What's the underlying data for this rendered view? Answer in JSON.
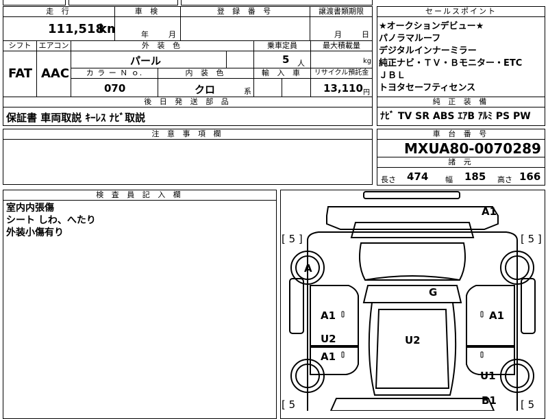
{
  "top_row": {
    "mileage_header": "走 行",
    "shaken_header": "車 検",
    "reg_header": "登 録 番 号",
    "transfer_header": "譲渡書類期限",
    "sales_header": "セールスポイント"
  },
  "mileage": {
    "value": "111,518",
    "unit": "km"
  },
  "shaken": {
    "year_unit": "年",
    "month_unit": "月"
  },
  "transfer": {
    "month_unit": "月",
    "day_unit": "日"
  },
  "row2_headers": {
    "shift": "シフト",
    "aircon": "エアコン",
    "exterior": "外 装 色",
    "capacity": "乗車定員",
    "max_load": "最大積載量"
  },
  "shift": "FAT",
  "aircon": "AAC",
  "exterior_color": "パール",
  "capacity": {
    "value": "5",
    "unit": "人"
  },
  "max_load": {
    "unit": "kg"
  },
  "row3_headers": {
    "color_no": "カ ラ ー Ｎ ｏ.",
    "interior": "内 装 色",
    "import": "輸 入 車",
    "recycle": "リサイクル預託金"
  },
  "color_no": "070",
  "interior_color": {
    "value": "クロ",
    "suffix": "系"
  },
  "recycle": {
    "value": "13,110",
    "unit": "円"
  },
  "sales_points": [
    "★オークションデビュー★",
    "パノラマルーフ",
    "デジタルインナーミラー",
    "純正ナビ・ＴＶ・Ｂモニター・ETC",
    "ＪＢＬ",
    "トヨタセーフティセンス"
  ],
  "after_parts": {
    "header": "後 日 発 送 部 品",
    "value": "保証書 車両取説 ｷｰﾚｽ ﾅﾋﾞ取説"
  },
  "equipment": {
    "header": "純 正 装 備",
    "value": "ﾅﾋﾞ TV SR ABS ｴｱB ｱﾙﾐ PS PW"
  },
  "notes": {
    "header": "注 意 事 項 欄"
  },
  "chassis": {
    "header": "車 台 番 号",
    "value": "MXUA80-0070289"
  },
  "specs": {
    "header": "諸 元",
    "length_label": "長さ",
    "length": "474",
    "width_label": "幅",
    "width": "185",
    "height_label": "高さ",
    "height": "166"
  },
  "inspector": {
    "header": "検 査 員 記 入 欄",
    "lines": [
      "室内内張傷",
      "シート しわ、へたり",
      "外装小傷有り"
    ]
  },
  "diagram": {
    "tire_left_top": "[ 5 ]",
    "tire_right_top": "[ 5 ]",
    "tire_left_bottom": "[ 5",
    "tire_right_bottom": "[ 5",
    "marks": {
      "front_bumper": "A1",
      "left_front_wheel": "A",
      "roof": "G",
      "left_front_door": "A1",
      "right_front_door": "A1",
      "left_rear_door_u": "U2",
      "left_rear_door_a": "A1",
      "rear_glass": "U2",
      "right_rear_wheel": "U1",
      "rear_bumper": "B1"
    }
  }
}
